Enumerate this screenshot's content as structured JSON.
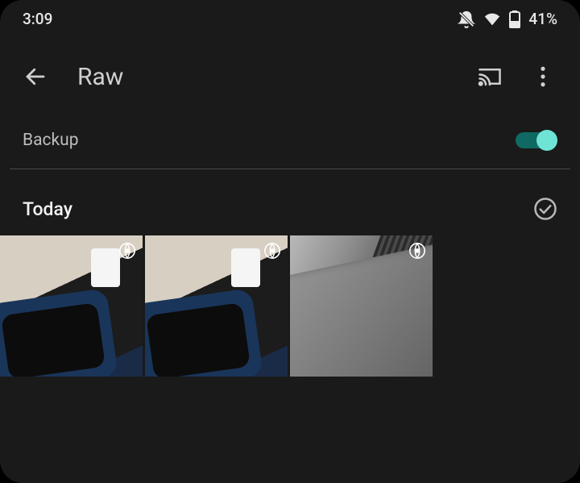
{
  "status": {
    "time": "3:09",
    "battery_pct": "41%"
  },
  "appbar": {
    "title": "Raw"
  },
  "backup": {
    "label": "Backup",
    "enabled": true
  },
  "section": {
    "title": "Today"
  },
  "photos": [
    {
      "id": "photo-1",
      "raw": true
    },
    {
      "id": "photo-2",
      "raw": true
    },
    {
      "id": "photo-3",
      "raw": true
    }
  ],
  "colors": {
    "bg": "#1a1a1a",
    "text": "#e6e6e6",
    "toggle_thumb": "#6fe3d5",
    "toggle_track": "#0f6a63"
  }
}
